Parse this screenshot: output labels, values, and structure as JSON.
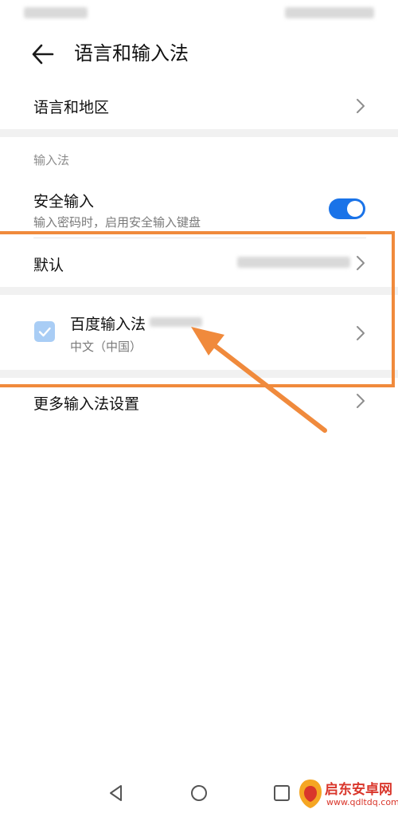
{
  "header": {
    "title": "语言和输入法"
  },
  "items": {
    "language_region": {
      "label": "语言和地区"
    },
    "section_input_method": {
      "label": "输入法"
    },
    "secure_input": {
      "label": "安全输入",
      "description": "输入密码时，启用安全输入键盘",
      "enabled": true
    },
    "default": {
      "label": "默认"
    },
    "baidu": {
      "label": "百度输入法",
      "sub": "中文（中国）",
      "checked": true
    },
    "more_settings": {
      "label": "更多输入法设置"
    }
  },
  "watermark": {
    "text": "启东安卓网",
    "url": "www.qdltdq.com"
  },
  "colors": {
    "accent": "#1a73e8",
    "annotation": "#f08a3c",
    "watermark": "#d9362b"
  }
}
